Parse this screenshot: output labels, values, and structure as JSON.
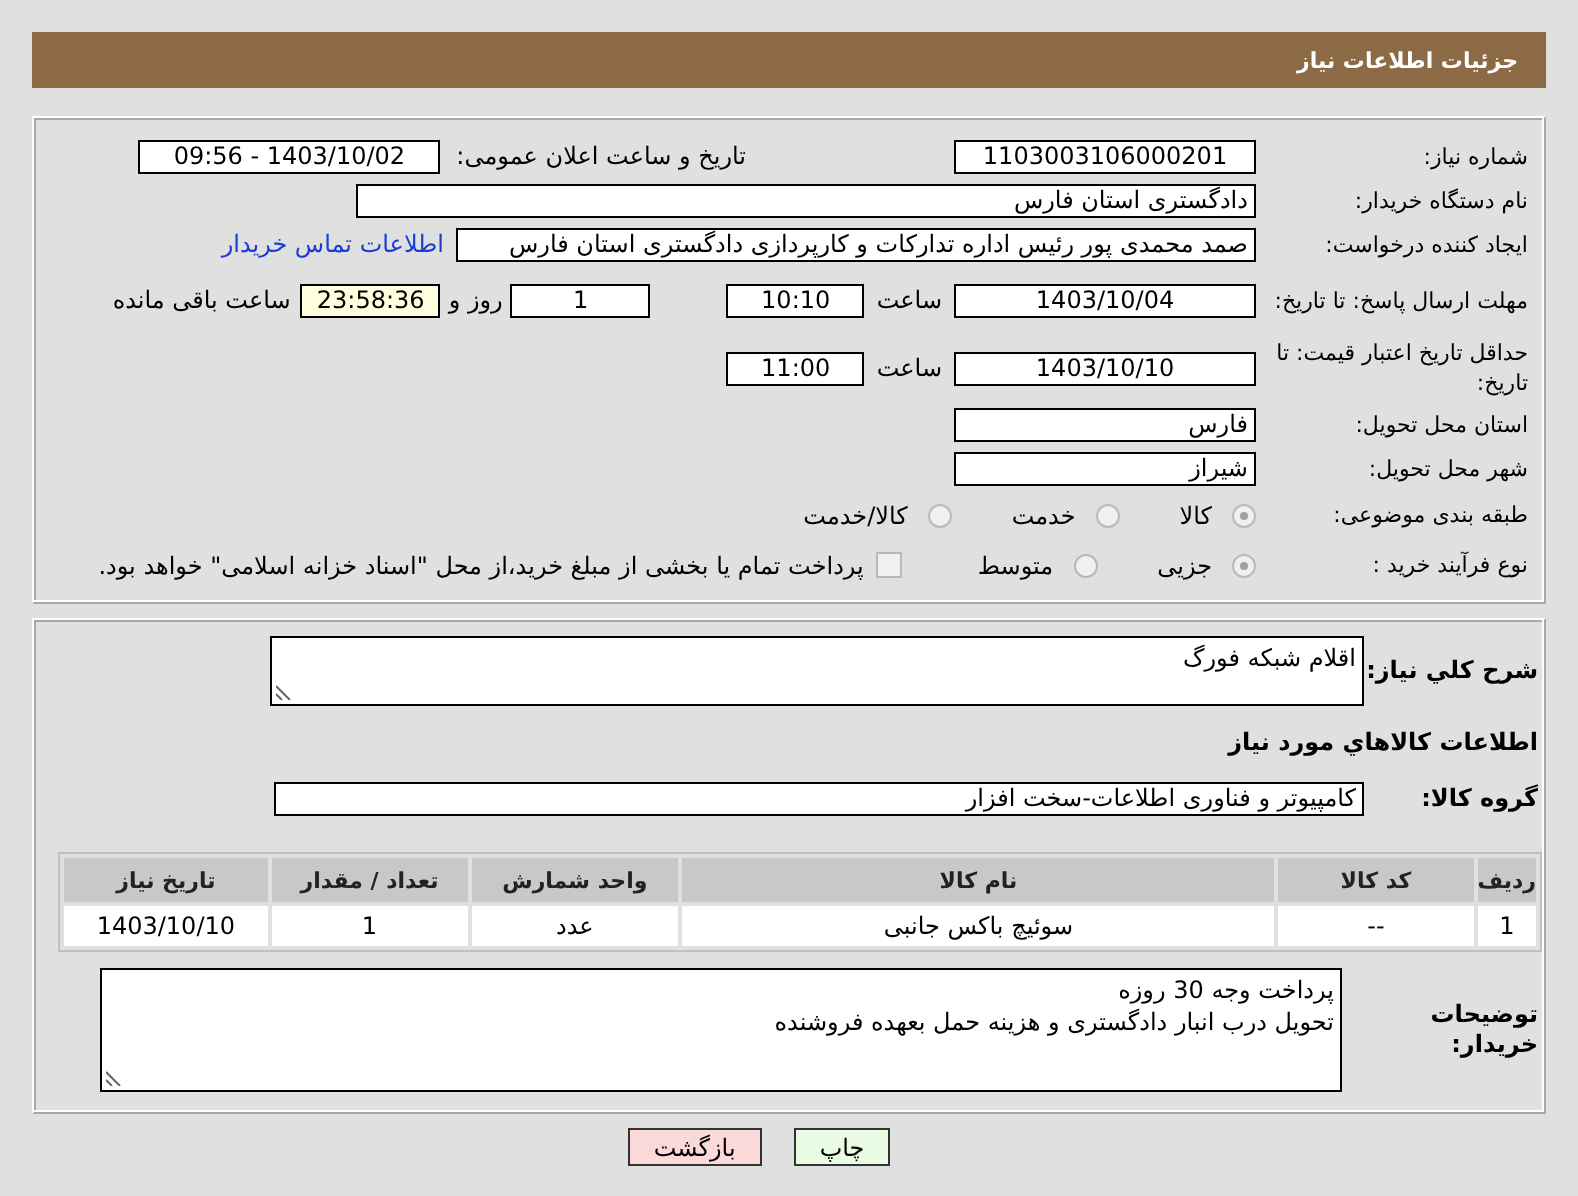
{
  "header": {
    "title": "جزئیات اطلاعات نیاز"
  },
  "details": {
    "need_number": {
      "label": "شماره نیاز:",
      "value": "1103003106000201"
    },
    "announce": {
      "label": "تاریخ و ساعت اعلان عمومی:",
      "value": "1403/10/02 - 09:56"
    },
    "buyer_org": {
      "label": "نام دستگاه خریدار:",
      "value": "دادگستری استان فارس"
    },
    "requester": {
      "label": "ایجاد کننده درخواست:",
      "value": "صمد محمدی پور رئیس اداره تدارکات و کارپردازی دادگستری استان فارس",
      "link": "اطلاعات تماس خریدار"
    },
    "reply_deadline": {
      "label": "مهلت ارسال پاسخ: تا تاریخ:",
      "date": "1403/10/04",
      "time_label": "ساعت",
      "time": "10:10",
      "days": "1",
      "days_label": "روز و",
      "remaining": "23:58:36",
      "remaining_label": "ساعت باقی مانده"
    },
    "price_validity": {
      "label": "حداقل تاریخ اعتبار قیمت: تا تاریخ:",
      "date": "1403/10/10",
      "time_label": "ساعت",
      "time": "11:00"
    },
    "province": {
      "label": "استان محل تحویل:",
      "value": "فارس"
    },
    "city": {
      "label": "شهر محل تحویل:",
      "value": "شیراز"
    },
    "category": {
      "label": "طبقه بندی موضوعی:",
      "options": [
        {
          "label": "کالا",
          "selected": true
        },
        {
          "label": "خدمت",
          "selected": false
        },
        {
          "label": "کالا/خدمت",
          "selected": false
        }
      ]
    },
    "purchase_process": {
      "label": "نوع فرآیند خرید :",
      "options": [
        {
          "label": "جزیی",
          "selected": true
        },
        {
          "label": "متوسط",
          "selected": false
        }
      ],
      "payment_note": {
        "label": "پرداخت تمام یا بخشی از مبلغ خرید،از محل \"اسناد خزانه اسلامی\" خواهد بود.",
        "checked": false
      }
    }
  },
  "description": {
    "label": "شرح کلي نیاز:",
    "value": "اقلام شبکه فورگ"
  },
  "goods_heading": "اطلاعات کالاهاي مورد نیاز",
  "goods_group": {
    "label": "گروه کالا:",
    "value": "کامپیوتر و فناوری اطلاعات-سخت افزار"
  },
  "table": {
    "columns": [
      "ردیف",
      "کد کالا",
      "نام کالا",
      "واحد شمارش",
      "تعداد / مقدار",
      "تاریخ نیاز"
    ],
    "rows": [
      [
        "1",
        "--",
        "سوئیچ باکس جانبی",
        "عدد",
        "1",
        "1403/10/10"
      ]
    ]
  },
  "buyer_notes": {
    "label": "توضیحات خریدار:",
    "lines": [
      "پرداخت وجه 30 روزه",
      "تحویل درب انبار دادگستری و هزینه حمل بعهده فروشنده"
    ]
  },
  "buttons": [
    {
      "label": "چاپ",
      "kind": "print"
    },
    {
      "label": "بازگشت",
      "kind": "back"
    }
  ]
}
